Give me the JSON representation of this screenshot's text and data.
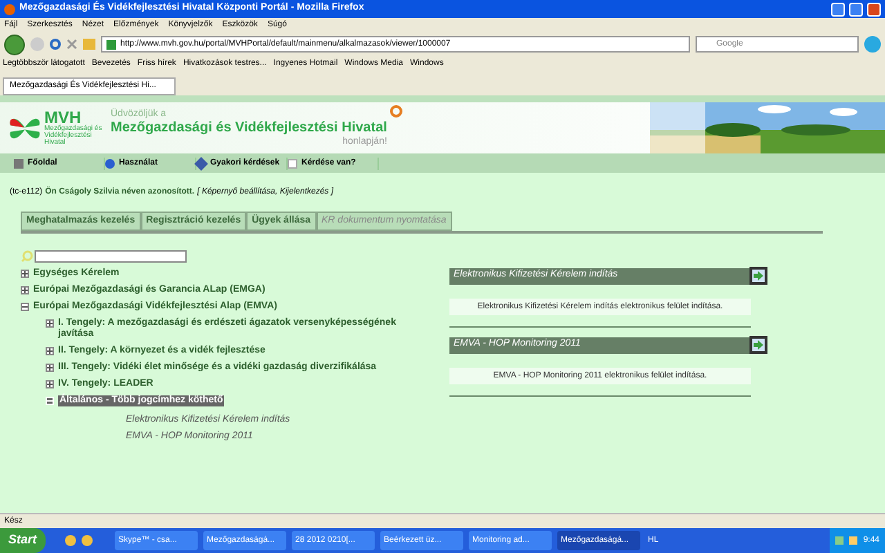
{
  "window": {
    "title": "Mezőgazdasági És Vidékfejlesztési Hivatal Központi Portál - Mozilla Firefox"
  },
  "menu": [
    "Fájl",
    "Szerkesztés",
    "Nézet",
    "Előzmények",
    "Könyvjelzők",
    "Eszközök",
    "Súgó"
  ],
  "address_bar": {
    "value": "http://www.mvh.gov.hu/portal/MVHPortal/default/mainmenu/alkalmazasok/viewer/1000007"
  },
  "search_box": {
    "placeholder": "Google"
  },
  "bookmarks": [
    "Legtöbbször látogatott",
    "Bevezetés",
    "Friss hírek",
    "Hivatkozások testres...",
    "Ingyenes Hotmail",
    "Windows Media",
    "Windows"
  ],
  "browser_tabs": [
    {
      "label": "Mezőgazdasági És Vidékfejlesztési Hi...",
      "selected": true
    }
  ],
  "header": {
    "logo": "MVH",
    "logo_subtitle": "Mezőgazdasági és Vidékfejlesztési Hivatal",
    "greeting": "Üdvözöljük a",
    "title": "Mezőgazdasági és Vidékfejlesztési Hivatal",
    "suffix": "honlapján!"
  },
  "toolbar": [
    "Főoldal",
    "Használat",
    "Gyakori kérdések",
    "Kérdése van?"
  ],
  "user_line": {
    "code": "(tc-e112)",
    "message": "Ön Cságoly Szilvia néven azonosított.",
    "links": "[ Képernyő beállítása, Kijelentkezés ]"
  },
  "page_tabs": [
    {
      "label": "Meghatalmazás kezelés",
      "disabled": false
    },
    {
      "label": "Regisztráció kezelés",
      "disabled": false
    },
    {
      "label": "Ügyek állása",
      "disabled": false
    },
    {
      "label": "KR dokumentum nyomtatása",
      "disabled": true
    }
  ],
  "tree": [
    {
      "label": "Egységes Kérelem",
      "expanded": false,
      "selected": false
    },
    {
      "label": "Európai Mezőgazdasági és Garancia ALap (EMGA)",
      "expanded": false,
      "selected": false
    },
    {
      "label": "Európai Mezőgazdasági Vidékfejlesztési Alap (EMVA)",
      "expanded": true,
      "selected": false,
      "children": [
        {
          "label": "I. Tengely: A mezőgazdasági és erdészeti ágazatok versenyképességének javítása",
          "expanded": false,
          "selected": false
        },
        {
          "label": "II. Tengely: A környezet és a vidék fejlesztése",
          "expanded": false,
          "selected": false
        },
        {
          "label": "III. Tengely: Vidéki élet minősége és a vidéki gazdaság diverzifikálása",
          "expanded": false,
          "selected": false
        },
        {
          "label": "IV. Tengely: LEADER",
          "expanded": false,
          "selected": false
        },
        {
          "label": "Általános - Több jogcímhez köthető",
          "expanded": true,
          "selected": true,
          "children": [
            {
              "label": "Elektronikus Kifizetési Kérelem indítás",
              "kind": "leaf"
            },
            {
              "label": "EMVA - HOP Monitoring 2011",
              "kind": "leaf"
            }
          ]
        }
      ]
    }
  ],
  "apps": [
    {
      "title": "Elektronikus Kifizetési Kérelem indítás",
      "description": "Elektronikus Kifizetési Kérelem indítás elektronikus felület indítása."
    },
    {
      "title": "EMVA - HOP Monitoring 2011",
      "description": "EMVA - HOP Monitoring 2011 elektronikus felület indítása."
    }
  ],
  "status_bar": "Kész",
  "taskbar": {
    "start": "Start",
    "items": [
      {
        "label": "Skype™ - csa...",
        "selected": false
      },
      {
        "label": "Mezőgazdaságá...",
        "selected": false
      },
      {
        "label": "28 2012 0210[...",
        "selected": false
      },
      {
        "label": "Beérkezett üz...",
        "selected": false
      },
      {
        "label": "Monitoring ad...",
        "selected": false
      },
      {
        "label": "Mezőgazdaságá...",
        "selected": true
      }
    ],
    "lang": "HL",
    "clock": "9:44"
  }
}
